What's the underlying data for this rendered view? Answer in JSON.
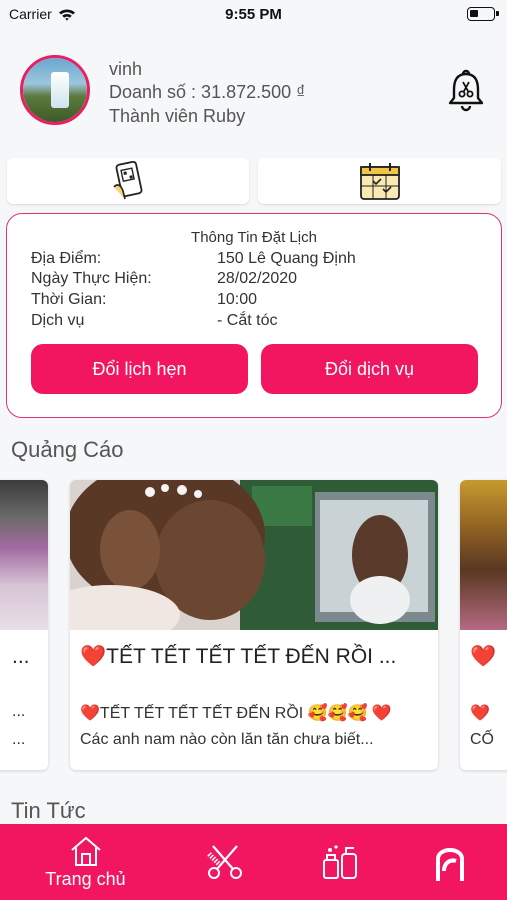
{
  "status_bar": {
    "carrier": "Carrier",
    "time": "9:55 PM"
  },
  "profile": {
    "name": "vinh",
    "revenue": "Doanh số : 31.872.500 ₫",
    "membership": "Thành viên Ruby"
  },
  "booking": {
    "title": "Thông Tin Đặt Lịch",
    "rows": [
      {
        "label": "Địa Điểm:",
        "value": "150 Lê Quang Định"
      },
      {
        "label": "Ngày Thực Hiện:",
        "value": "28/02/2020"
      },
      {
        "label": "Thời Gian:",
        "value": "10:00"
      },
      {
        "label": "Dịch vụ",
        "value": "- Cắt tóc"
      }
    ],
    "change_schedule_label": "Đổi lịch hẹn",
    "change_service_label": "Đổi dịch vụ"
  },
  "ads": {
    "section_title": "Quảng Cáo",
    "left_partial": {
      "title": "...",
      "desc": "..."
    },
    "main": {
      "title": "❤️TẾT TẾT TẾT TẾT ĐẾN RỒI ...",
      "desc1": "❤️TẾT TẾT TẾT TẾT ĐẾN RỒI 🥰🥰🥰 ❤️",
      "desc2": "Các anh nam nào còn lăn tăn chưa biết..."
    },
    "right_partial": {
      "title": "❤️",
      "desc1": "❤️",
      "desc2": "CỐ"
    }
  },
  "news": {
    "section_title": "Tin Tức"
  },
  "tabbar": {
    "home_label": "Trang chủ"
  },
  "colors": {
    "accent": "#f2155f",
    "border": "#e0346b"
  },
  "icons": [
    "wifi-icon",
    "battery-icon",
    "bell-scissors-icon",
    "phone-scan-icon",
    "calendar-icon",
    "home-icon",
    "scissors-comb-icon",
    "cosmetics-icon",
    "hair-logo-icon"
  ]
}
